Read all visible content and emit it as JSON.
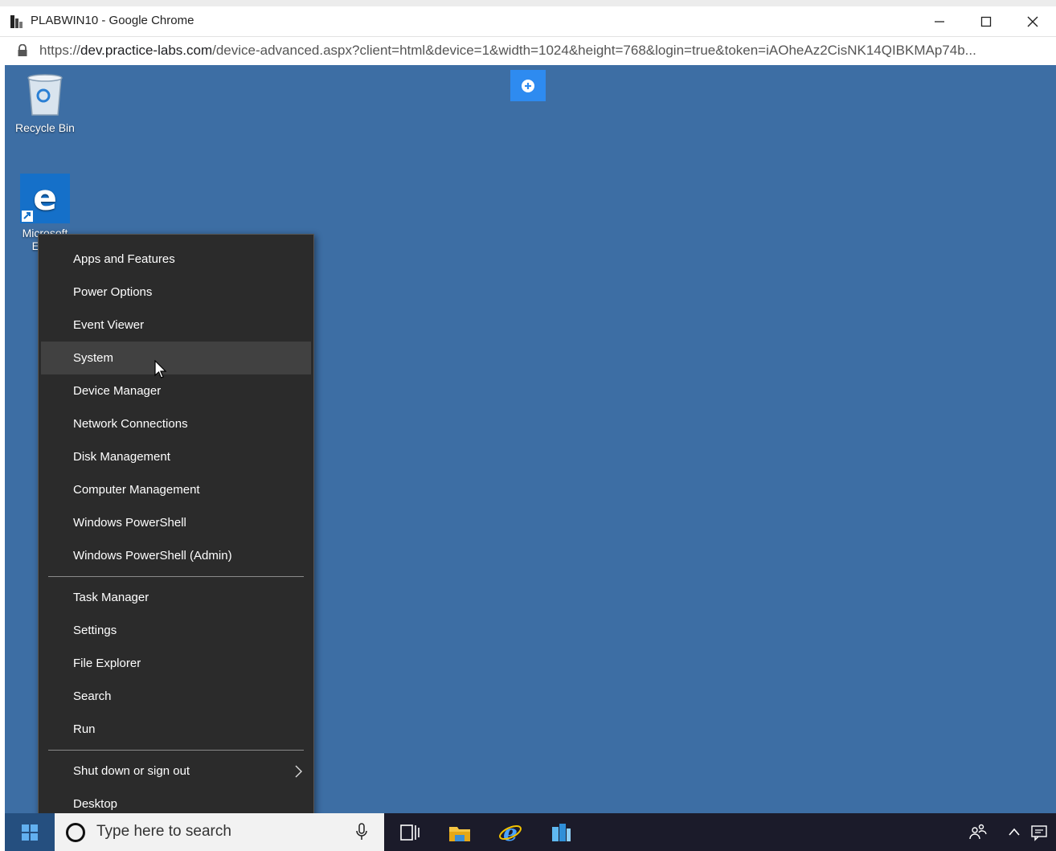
{
  "window": {
    "title": "PLABWIN10 - Google Chrome",
    "controls": {
      "minimize": "minimize-icon",
      "maximize": "maximize-icon",
      "close": "close-icon"
    }
  },
  "address": {
    "url_prefix": "https://",
    "url_host": "dev.practice-labs.com",
    "url_path": "/device-advanced.aspx?client=html&device=1&width=1024&height=768&login=true&token=iAOheAz2CisNK14QIBKMAp74b..."
  },
  "desktop": {
    "background": "#3d6ea4",
    "icons": [
      {
        "label": "Recycle Bin",
        "icon": "recycle-bin-icon"
      },
      {
        "label": "Microsoft Edge",
        "icon": "edge-icon"
      }
    ]
  },
  "menu": {
    "groups": [
      [
        "Apps and Features",
        "Power Options",
        "Event Viewer",
        "System",
        "Device Manager",
        "Network Connections",
        "Disk Management",
        "Computer Management",
        "Windows PowerShell",
        "Windows PowerShell (Admin)"
      ],
      [
        "Task Manager",
        "Settings",
        "File Explorer",
        "Search",
        "Run"
      ],
      [
        "Shut down or sign out",
        "Desktop"
      ]
    ],
    "highlighted": "System",
    "submenu_item": "Shut down or sign out"
  },
  "taskbar": {
    "search_placeholder": "Type here to search",
    "pinned": [
      "task-view-icon",
      "file-explorer-icon",
      "internet-explorer-icon",
      "server-manager-icon"
    ],
    "tray": [
      "people-icon",
      "chevron-up-icon",
      "notification-icon"
    ]
  }
}
